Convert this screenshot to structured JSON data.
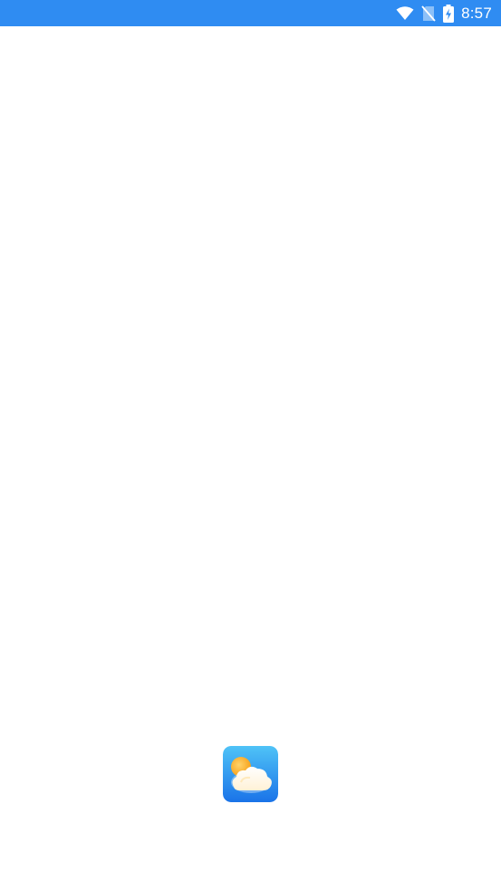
{
  "status_bar": {
    "time": "8:57",
    "background_color": "#2f8cf2",
    "icons": [
      "wifi-icon",
      "no-sim-icon",
      "battery-charging-icon"
    ]
  },
  "splash": {
    "background_color": "#ffffff",
    "logo_icon": "weather-app-logo"
  }
}
